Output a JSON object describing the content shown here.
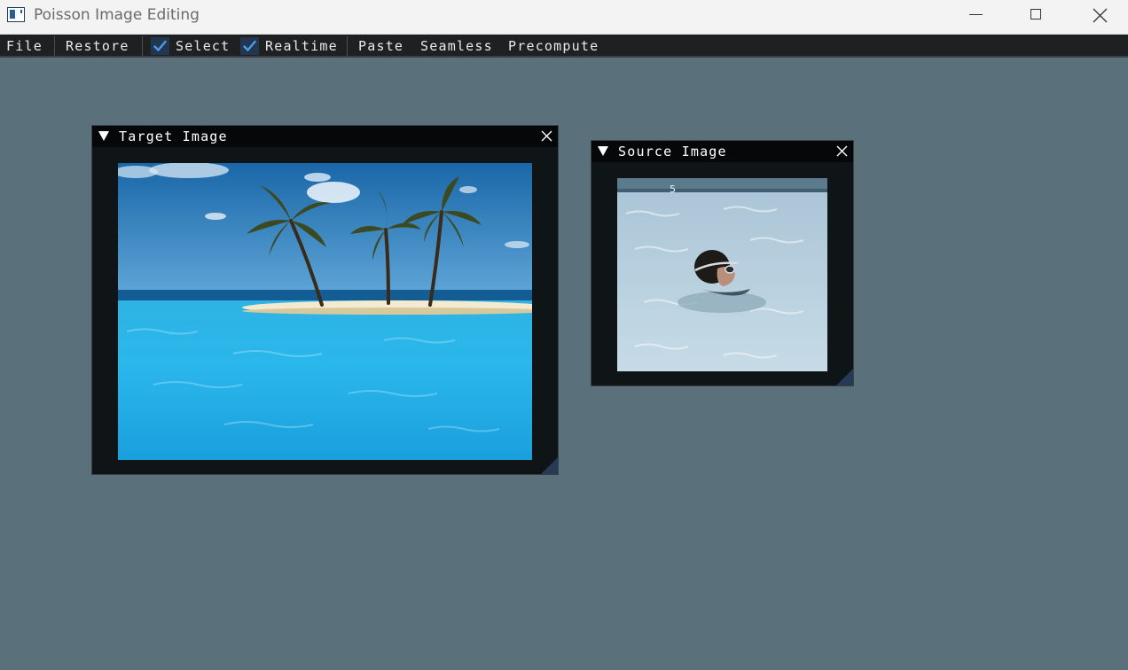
{
  "window": {
    "title": "Poisson Image Editing",
    "icon": "app-window-icon",
    "controls": [
      "minimize-icon",
      "maximize-icon",
      "close-icon"
    ]
  },
  "menubar": {
    "file": "File",
    "restore": "Restore",
    "select": {
      "label": "Select",
      "checked": true
    },
    "realtime": {
      "label": "Realtime",
      "checked": true
    },
    "paste": "Paste",
    "seamless": "Seamless",
    "precompute": "Precompute"
  },
  "target_window": {
    "title": "Target Image",
    "image_description": "Tropical island with three palm trees in turquoise sea",
    "icons": [
      "collapse-arrow-icon",
      "close-icon",
      "resize-grip-icon"
    ]
  },
  "source_window": {
    "title": "Source Image",
    "image_description": "Swimmer with goggles in a pool, lane marker 5",
    "pool_marker": "5",
    "icons": [
      "collapse-arrow-icon",
      "close-icon",
      "resize-grip-icon"
    ]
  },
  "colors": {
    "background": "#5a717c",
    "menubar": "#1f2022",
    "window_bg": "#0f1416",
    "title_bg": "#060708",
    "check_mark": "#4a9be8",
    "check_bg": "#22364f"
  }
}
